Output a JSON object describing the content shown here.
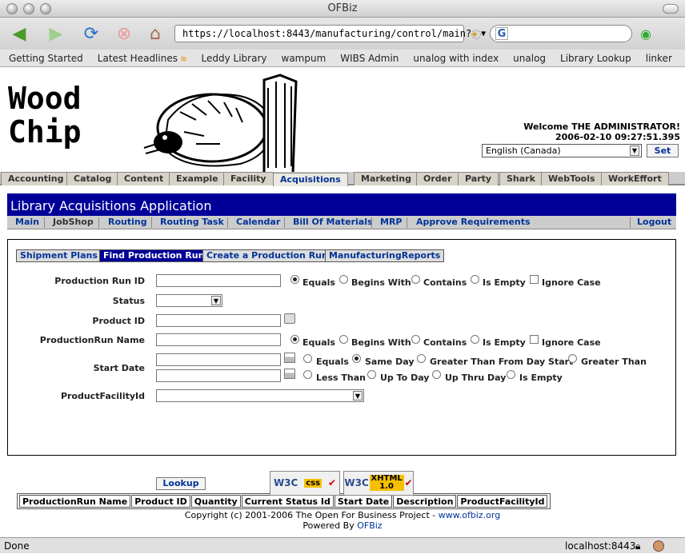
{
  "window": {
    "title": "OFBiz"
  },
  "toolbar": {
    "url": "https://localhost:8443/manufacturing/control/main?",
    "search_placeholder": ""
  },
  "bookmarks": [
    "Getting Started",
    "Latest Headlines",
    "Leddy Library",
    "wampum",
    "WIBS Admin",
    "unalog with index",
    "unalog",
    "Library Lookup",
    "linker"
  ],
  "header": {
    "logo_line1": "Wood",
    "logo_line2": "Chip",
    "welcome": "Welcome THE ADMINISTRATOR!",
    "datetime": "2006-02-10 09:27:51.395",
    "language": "English (Canada)",
    "set_label": "Set"
  },
  "main_tabs": [
    "Accounting",
    "Catalog",
    "Content",
    "Example",
    "Facility",
    "Acquisitions",
    "Marketing",
    "Order",
    "Party",
    "Shark",
    "WebTools",
    "WorkEffort"
  ],
  "selected_tab": "Acquisitions",
  "app_title": "Library Acquisitions Application",
  "subnav": [
    "Main",
    "JobShop",
    "Routing",
    "Routing Task",
    "Calendar",
    "Bill Of Materials",
    "MRP",
    "Approve Requirements"
  ],
  "subnav_selected": "JobShop",
  "logout": "Logout",
  "button_tabs": [
    "Shipment Plans",
    "Find Production Run",
    "Create a Production Run",
    "ManufacturingReports"
  ],
  "form": {
    "production_run_id": "Production Run ID",
    "status": "Status",
    "product_id": "Product ID",
    "production_run_name": "ProductionRun Name",
    "start_date": "Start Date",
    "product_facility_id": "ProductFacilityId",
    "text_ops": [
      "Equals",
      "Begins With",
      "Contains",
      "Is Empty",
      "Ignore Case"
    ],
    "date_ops_row1": [
      "Equals",
      "Same Day",
      "Greater Than From Day Start",
      "Greater Than"
    ],
    "date_ops_row2": [
      "Less Than",
      "Up To Day",
      "Up Thru Day",
      "Is Empty"
    ],
    "lookup": "Lookup"
  },
  "results_columns": [
    "ProductionRun Name",
    "Product ID",
    "Quantity",
    "Current Status Id",
    "Start Date",
    "Description",
    "ProductFacilityId"
  ],
  "badges": {
    "w3c": "W3C",
    "css": "css",
    "xhtml": "XHTML",
    "xhtml_ver": "1.0"
  },
  "footer": {
    "copyright": "Copyright (c) 2001-2006 The Open For Business Project - ",
    "link": "www.ofbiz.org",
    "powered": "Powered By ",
    "powered_link": "OFBiz"
  },
  "status": {
    "left": "Done",
    "right": "localhost:8443"
  }
}
